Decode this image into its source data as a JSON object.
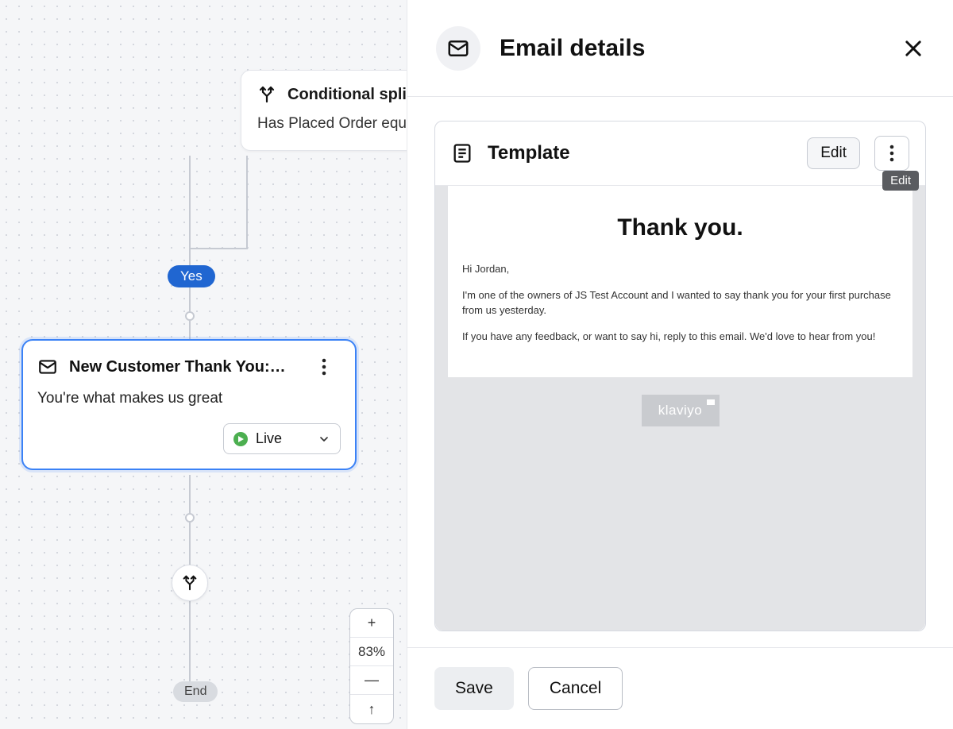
{
  "canvas": {
    "cond_split": {
      "title": "Conditional split",
      "subtitle": "Has Placed Order equals"
    },
    "branch_label": "Yes",
    "email_card": {
      "title": "New Customer Thank You:…",
      "subtitle": "You're what makes us great",
      "status_label": "Live"
    },
    "end_label": "End",
    "zoom": {
      "plus": "+",
      "percent": "83%",
      "minus": "—",
      "up": "↑"
    }
  },
  "panel": {
    "title": "Email details",
    "template": {
      "heading": "Template",
      "edit_label": "Edit",
      "tooltip": "Edit",
      "preview": {
        "headline": "Thank you.",
        "greeting": "Hi Jordan,",
        "para1": "I'm one of the owners of JS Test Account and I wanted to say thank you for your first purchase from us yesterday.",
        "para2": "If you have any feedback, or want to say hi, reply to this email. We'd love to hear from you!",
        "badge": "klaviyo"
      }
    },
    "footer": {
      "save": "Save",
      "cancel": "Cancel"
    }
  }
}
